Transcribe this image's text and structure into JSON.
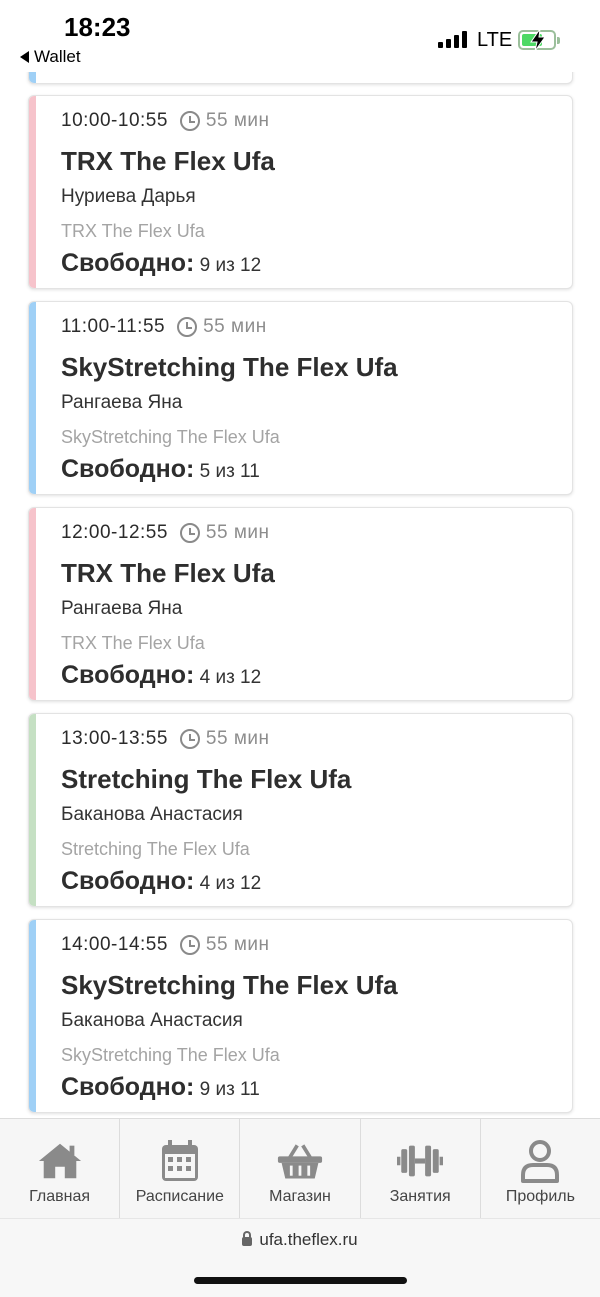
{
  "status_bar": {
    "time": "18:23",
    "back_app": "Wallet",
    "network": "LTE"
  },
  "colors": {
    "pink": "#f6c3cb",
    "blue": "#9fd0f6",
    "green": "#c5e0c3"
  },
  "classes": [
    {
      "time": "10:00-10:55",
      "duration": "55 мин",
      "title": "TRX The Flex Ufa",
      "trainer": "Нуриева Дарья",
      "studio": "TRX The Flex Ufa",
      "free_label": "Свободно:",
      "free_value": "9 из 12",
      "color": "pink"
    },
    {
      "time": "11:00-11:55",
      "duration": "55 мин",
      "title": "SkyStretching The Flex Ufa",
      "trainer": "Рангаева Яна",
      "studio": "SkyStretching The Flex Ufa",
      "free_label": "Свободно:",
      "free_value": "5 из 11",
      "color": "blue"
    },
    {
      "time": "12:00-12:55",
      "duration": "55 мин",
      "title": "TRX The Flex Ufa",
      "trainer": "Рангаева Яна",
      "studio": "TRX The Flex Ufa",
      "free_label": "Свободно:",
      "free_value": "4 из 12",
      "color": "pink"
    },
    {
      "time": "13:00-13:55",
      "duration": "55 мин",
      "title": "Stretching The Flex Ufa",
      "trainer": "Баканова Анастасия",
      "studio": "Stretching The Flex Ufa",
      "free_label": "Свободно:",
      "free_value": "4 из 12",
      "color": "green"
    },
    {
      "time": "14:00-14:55",
      "duration": "55 мин",
      "title": "SkyStretching The Flex Ufa",
      "trainer": "Баканова Анастасия",
      "studio": "SkyStretching The Flex Ufa",
      "free_label": "Свободно:",
      "free_value": "9 из 11",
      "color": "blue"
    }
  ],
  "tabs": [
    {
      "label": "Главная",
      "icon": "home-icon"
    },
    {
      "label": "Расписание",
      "icon": "calendar-icon"
    },
    {
      "label": "Магазин",
      "icon": "basket-icon"
    },
    {
      "label": "Занятия",
      "icon": "dumbbell-icon"
    },
    {
      "label": "Профиль",
      "icon": "user-icon"
    }
  ],
  "browser": {
    "url": "ufa.theflex.ru"
  }
}
